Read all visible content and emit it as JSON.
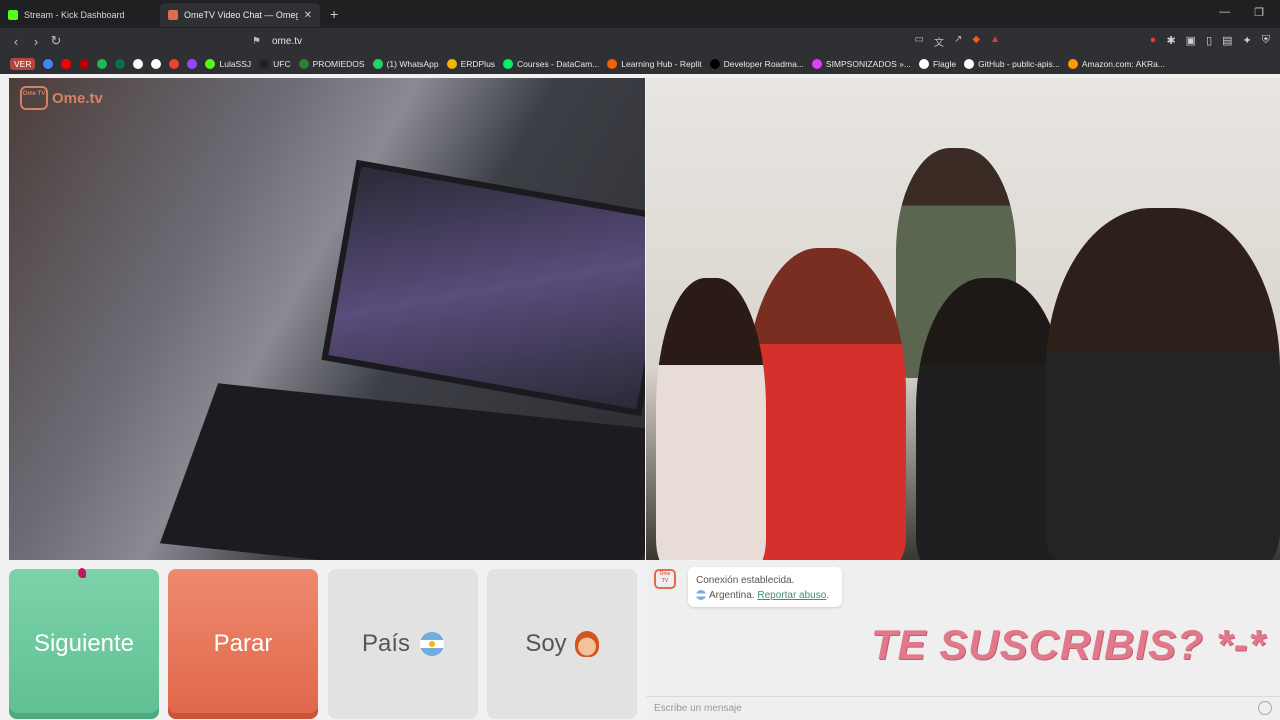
{
  "browser": {
    "tabs": [
      {
        "title": "Stream - Kick Dashboard",
        "active": false,
        "favicon_color": "#53fc18"
      },
      {
        "title": "OmeTV Video Chat — Omeg",
        "active": true,
        "favicon_color": "#e06b4e"
      }
    ],
    "url": "ome.tv",
    "bookmarks": [
      {
        "label": "VER",
        "color": "#b2463c",
        "tag": true
      },
      {
        "label": "",
        "color": "#4285f4"
      },
      {
        "label": "",
        "color": "#ff0000"
      },
      {
        "label": "",
        "color": "#b30000"
      },
      {
        "label": "",
        "color": "#1db954"
      },
      {
        "label": "",
        "color": "#0b6e4f"
      },
      {
        "label": "",
        "color": "#ffffff"
      },
      {
        "label": "",
        "color": "#ffffff"
      },
      {
        "label": "",
        "color": "#ea4335"
      },
      {
        "label": "",
        "color": "#9146ff"
      },
      {
        "label": "LulaSSJ",
        "color": "#53fc18"
      },
      {
        "label": "UFC",
        "color": "#222222"
      },
      {
        "label": "PROMIEDOS",
        "color": "#2e7d32"
      },
      {
        "label": "(1) WhatsApp",
        "color": "#25d366"
      },
      {
        "label": "ERDPlus",
        "color": "#f4b400"
      },
      {
        "label": "Courses - DataCam...",
        "color": "#03ef62"
      },
      {
        "label": "Learning Hub - Replit",
        "color": "#f26207"
      },
      {
        "label": "Developer Roadma...",
        "color": "#000000"
      },
      {
        "label": "SIMPSONIZADOS »...",
        "color": "#e040fb"
      },
      {
        "label": "Flagle",
        "color": "#ffffff"
      },
      {
        "label": "GitHub - public-apis...",
        "color": "#ffffff"
      },
      {
        "label": "Amazon.com: AKRa...",
        "color": "#ff9900"
      }
    ]
  },
  "page": {
    "logo_text": "Ome.tv",
    "logo_small": "Ome TV",
    "buttons": {
      "next": "Siguiente",
      "stop": "Parar",
      "country": "País",
      "gender": "Soy"
    },
    "chat": {
      "status_line": "Conexión establecida.",
      "country": "Argentina.",
      "report_link": "Reportar abuso",
      "report_suffix": ".",
      "input_placeholder": "Escribe un mensaje",
      "overlay_text": "TE SUSCRIBIS? *-*"
    }
  },
  "colors": {
    "next_button": "#6fc99e",
    "stop_button": "#e6745a",
    "neutral_button": "#e2e2e2",
    "overlay_text": "#e07a8a"
  }
}
